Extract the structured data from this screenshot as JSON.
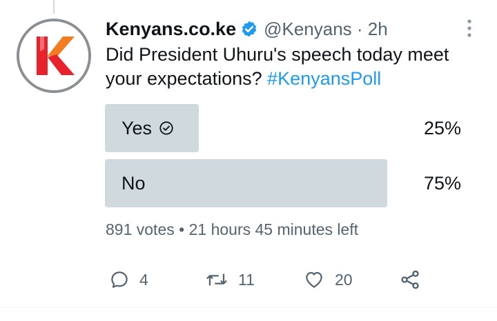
{
  "tweet": {
    "author_name": "Kenyans.co.ke",
    "handle": "@Kenyans",
    "separator": " · ",
    "time": "2h",
    "text": "Did President Uhuru's speech today meet your expectations?",
    "hashtag": "#KenyansPoll",
    "verified": true
  },
  "poll": {
    "options": [
      {
        "label": "Yes",
        "percent": "25%",
        "value": 0.25,
        "selected": true
      },
      {
        "label": "No",
        "percent": "75%",
        "value": 0.75,
        "selected": false
      }
    ],
    "votes": "891 votes",
    "meta_separator": " • ",
    "time_left": "21 hours 45 minutes left"
  },
  "actions": {
    "reply_count": "4",
    "retweet_count": "11",
    "like_count": "20"
  },
  "icons": {
    "more": "more-vertical-icon",
    "verified": "verified-badge-icon",
    "check": "check-circle-icon",
    "reply": "reply-icon",
    "retweet": "retweet-icon",
    "like": "heart-icon",
    "share": "share-icon"
  },
  "colors": {
    "accent": "#1d9bf0",
    "poll_fill": "#cfd9de",
    "muted_text": "#536471",
    "brand_red": "#e8222b",
    "brand_orange": "#f47c20"
  }
}
